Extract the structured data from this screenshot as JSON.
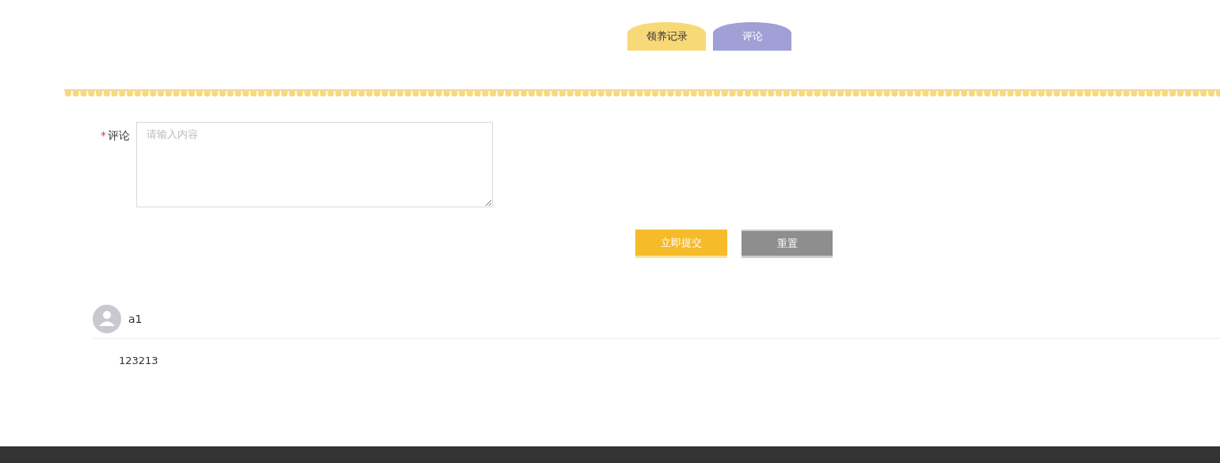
{
  "tabs": [
    {
      "label": "领养记录",
      "selected": false
    },
    {
      "label": "评论",
      "selected": true
    }
  ],
  "form": {
    "label": "评论",
    "required_mark": "*",
    "placeholder": "请输入内容"
  },
  "buttons": [
    {
      "label": "立即提交",
      "kind": "primary"
    },
    {
      "label": "重置",
      "kind": "secondary"
    }
  ],
  "comments": [
    {
      "user": "a1",
      "text": "123213"
    }
  ]
}
